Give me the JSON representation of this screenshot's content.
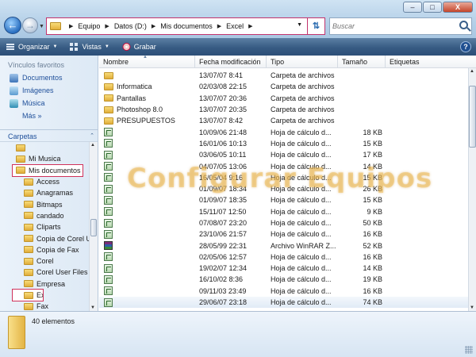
{
  "address": {
    "crumbs": [
      "Equipo",
      "Datos (D:)",
      "Mis documentos",
      "Excel"
    ]
  },
  "search": {
    "placeholder": "Buscar"
  },
  "toolbar": {
    "organize": "Organizar",
    "views": "Vistas",
    "burn": "Grabar"
  },
  "sidebar": {
    "favorites_title": "Vínculos favoritos",
    "favorites": [
      "Documentos",
      "Imágenes",
      "Música"
    ],
    "more": "Más",
    "folders_title": "Carpetas",
    "tree": [
      {
        "label": "",
        "indent": 1
      },
      {
        "label": "Mi Musica",
        "indent": 1
      },
      {
        "label": "Mis documentos",
        "indent": 1,
        "highlight": true
      },
      {
        "label": "Access",
        "indent": 2
      },
      {
        "label": "Anagramas",
        "indent": 2
      },
      {
        "label": "Bitmaps",
        "indent": 2
      },
      {
        "label": "candado",
        "indent": 2
      },
      {
        "label": "Cliparts",
        "indent": 2
      },
      {
        "label": "Copia de Corel U",
        "indent": 2
      },
      {
        "label": "Copia de Fax",
        "indent": 2
      },
      {
        "label": "Corel",
        "indent": 2
      },
      {
        "label": "Corel User Files",
        "indent": 2
      },
      {
        "label": "Empresa",
        "indent": 2
      },
      {
        "label": "Excel",
        "indent": 2,
        "highlight": true
      },
      {
        "label": "Fax",
        "indent": 2
      }
    ]
  },
  "columns": {
    "name": "Nombre",
    "date": "Fecha modificación",
    "type": "Tipo",
    "size": "Tamaño",
    "tags": "Etiquetas"
  },
  "files": [
    {
      "icon": "folder",
      "name": "",
      "date": "13/07/07 8:41",
      "type": "Carpeta de archivos",
      "size": ""
    },
    {
      "icon": "folder",
      "name": "Informatica",
      "date": "02/03/08 22:15",
      "type": "Carpeta de archivos",
      "size": ""
    },
    {
      "icon": "folder",
      "name": "Pantallas",
      "date": "13/07/07 20:36",
      "type": "Carpeta de archivos",
      "size": ""
    },
    {
      "icon": "folder",
      "name": "Photoshop 8.0",
      "date": "13/07/07 20:35",
      "type": "Carpeta de archivos",
      "size": ""
    },
    {
      "icon": "folder",
      "name": "PRESUPUESTOS",
      "date": "13/07/07 8:42",
      "type": "Carpeta de archivos",
      "size": ""
    },
    {
      "icon": "xls",
      "name": "",
      "date": "10/09/06 21:48",
      "type": "Hoja de cálculo d...",
      "size": "18 KB"
    },
    {
      "icon": "xls",
      "name": "",
      "date": "16/01/06 10:13",
      "type": "Hoja de cálculo d...",
      "size": "15 KB"
    },
    {
      "icon": "xls",
      "name": "",
      "date": "03/06/05 10:11",
      "type": "Hoja de cálculo d...",
      "size": "17 KB"
    },
    {
      "icon": "xls",
      "name": "",
      "date": "04/07/05 13:06",
      "type": "Hoja de cálculo d...",
      "size": "14 KB"
    },
    {
      "icon": "xls",
      "name": "",
      "date": "16/05/04 9:16",
      "type": "Hoja de cálculo d...",
      "size": "15 KB"
    },
    {
      "icon": "xls",
      "name": "",
      "date": "01/09/07 18:34",
      "type": "Hoja de cálculo d...",
      "size": "26 KB"
    },
    {
      "icon": "xls",
      "name": "",
      "date": "01/09/07 18:35",
      "type": "Hoja de cálculo d...",
      "size": "15 KB"
    },
    {
      "icon": "xls",
      "name": "",
      "date": "15/11/07 12:50",
      "type": "Hoja de cálculo d...",
      "size": "9 KB"
    },
    {
      "icon": "xls",
      "name": "",
      "date": "07/08/07 23:20",
      "type": "Hoja de cálculo d...",
      "size": "50 KB"
    },
    {
      "icon": "xls",
      "name": "",
      "date": "23/10/06 21:57",
      "type": "Hoja de cálculo d...",
      "size": "16 KB"
    },
    {
      "icon": "rar",
      "name": "",
      "date": "28/05/99 22:31",
      "type": "Archivo WinRAR Z...",
      "size": "52 KB"
    },
    {
      "icon": "xls",
      "name": "",
      "date": "02/05/06 12:57",
      "type": "Hoja de cálculo d...",
      "size": "16 KB"
    },
    {
      "icon": "xls",
      "name": "",
      "date": "19/02/07 12:34",
      "type": "Hoja de cálculo d...",
      "size": "14 KB"
    },
    {
      "icon": "xls",
      "name": "",
      "date": "16/10/02 8:36",
      "type": "Hoja de cálculo d...",
      "size": "19 KB"
    },
    {
      "icon": "xls",
      "name": "",
      "date": "09/11/03 23:49",
      "type": "Hoja de cálculo d...",
      "size": "16 KB"
    },
    {
      "icon": "xls",
      "name": "",
      "date": "29/06/07 23:18",
      "type": "Hoja de cálculo d...",
      "size": "74 KB",
      "selected": true
    }
  ],
  "watermark": "Configurar Equipos",
  "status": {
    "count": "40 elementos"
  },
  "window_buttons": {
    "minimize": "–",
    "maximize": "□",
    "close": "X"
  },
  "colors": {
    "accent": "#375b83",
    "highlight_box": "#d0315a"
  }
}
